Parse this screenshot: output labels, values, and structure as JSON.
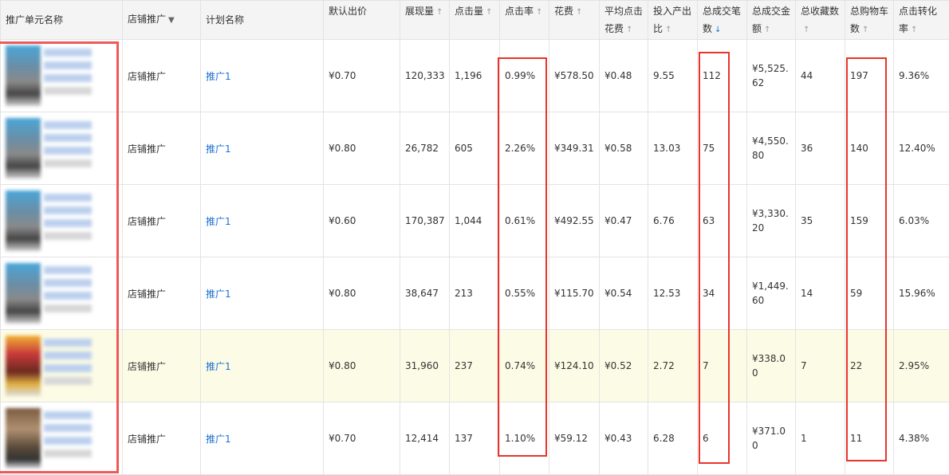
{
  "columns": [
    {
      "label": "推广单元名称",
      "sort": "none"
    },
    {
      "label": "店铺推广",
      "sort": "dropdown"
    },
    {
      "label": "计划名称",
      "sort": "none"
    },
    {
      "label": "默认出价",
      "sort": "none"
    },
    {
      "label": "展现量",
      "sort": "up"
    },
    {
      "label": "点击量",
      "sort": "up"
    },
    {
      "label": "点击率",
      "sort": "up"
    },
    {
      "label": "花费",
      "sort": "up"
    },
    {
      "label": "平均点击花费",
      "sort": "up"
    },
    {
      "label": "投入产出比",
      "sort": "up"
    },
    {
      "label": "总成交笔数",
      "sort": "down-active"
    },
    {
      "label": "总成交金额",
      "sort": "up"
    },
    {
      "label": "总收藏数",
      "sort": "up"
    },
    {
      "label": "总购物车数",
      "sort": "up"
    },
    {
      "label": "点击转化率",
      "sort": "up"
    }
  ],
  "rows": [
    {
      "type": "店铺推广",
      "plan": "推广1",
      "bid": "¥0.70",
      "impressions": "120,333",
      "clicks": "1,196",
      "ctr": "0.99%",
      "cost": "¥578.50",
      "cpc": "¥0.48",
      "roi": "9.55",
      "orders": "112",
      "gmv": "¥5,525.62",
      "favorites": "44",
      "carts": "197",
      "cvr": "9.36%"
    },
    {
      "type": "店铺推广",
      "plan": "推广1",
      "bid": "¥0.80",
      "impressions": "26,782",
      "clicks": "605",
      "ctr": "2.26%",
      "cost": "¥349.31",
      "cpc": "¥0.58",
      "roi": "13.03",
      "orders": "75",
      "gmv": "¥4,550.80",
      "favorites": "36",
      "carts": "140",
      "cvr": "12.40%"
    },
    {
      "type": "店铺推广",
      "plan": "推广1",
      "bid": "¥0.60",
      "impressions": "170,387",
      "clicks": "1,044",
      "ctr": "0.61%",
      "cost": "¥492.55",
      "cpc": "¥0.47",
      "roi": "6.76",
      "orders": "63",
      "gmv": "¥3,330.20",
      "favorites": "35",
      "carts": "159",
      "cvr": "6.03%"
    },
    {
      "type": "店铺推广",
      "plan": "推广1",
      "bid": "¥0.80",
      "impressions": "38,647",
      "clicks": "213",
      "ctr": "0.55%",
      "cost": "¥115.70",
      "cpc": "¥0.54",
      "roi": "12.53",
      "orders": "34",
      "gmv": "¥1,449.60",
      "favorites": "14",
      "carts": "59",
      "cvr": "15.96%"
    },
    {
      "type": "店铺推广",
      "plan": "推广1",
      "bid": "¥0.80",
      "impressions": "31,960",
      "clicks": "237",
      "ctr": "0.74%",
      "cost": "¥124.10",
      "cpc": "¥0.52",
      "roi": "2.72",
      "orders": "7",
      "gmv": "¥338.00",
      "favorites": "7",
      "carts": "22",
      "cvr": "2.95%"
    },
    {
      "type": "店铺推广",
      "plan": "推广1",
      "bid": "¥0.70",
      "impressions": "12,414",
      "clicks": "137",
      "ctr": "1.10%",
      "cost": "¥59.12",
      "cpc": "¥0.43",
      "roi": "6.28",
      "orders": "6",
      "gmv": "¥371.00",
      "favorites": "1",
      "carts": "11",
      "cvr": "4.38%"
    }
  ],
  "highlight_row_color": "#fcfce6",
  "annotation_color": "#e8342c"
}
